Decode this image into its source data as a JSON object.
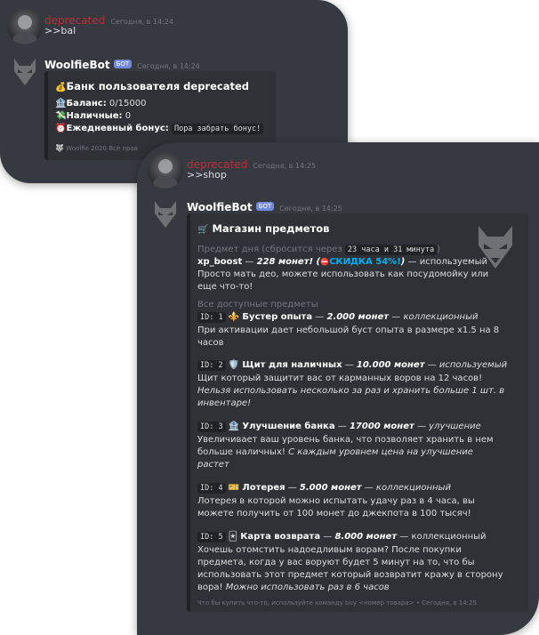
{
  "card1": {
    "user_msg": {
      "username": "deprecated",
      "timestamp": "Сегодня, в 14:24",
      "text": ">>bal"
    },
    "bot_msg": {
      "username": "WoolfieBot",
      "badge": "БОТ",
      "timestamp": "Сегодня, в 14:24"
    },
    "embed": {
      "title_icon": "money-bag-icon",
      "title": "Банк пользователя deprecated",
      "balance_label": "Баланс:",
      "balance_value": "0/15000",
      "cash_label": "Наличные:",
      "cash_value": "0",
      "bonus_label": "Ежедневный бонус:",
      "bonus_value": "Пора забрать бонус!",
      "footer": "Woolfie 2020 Все прав"
    }
  },
  "card2": {
    "user_msg": {
      "username": "deprecated",
      "timestamp": "Сегодня, в 14:25",
      "text": ">>shop"
    },
    "bot_msg": {
      "username": "WoolfieBot",
      "badge": "БОТ",
      "timestamp": "Сегодня, в 14:25"
    },
    "embed": {
      "title": "Магазин предметов",
      "deal_label": "Предмет дня (сбросится через",
      "deal_timer": "23 часа и 31 минута",
      "deal_close": ")",
      "deal_item": "xp_boost",
      "deal_price": "228 монет! (",
      "deal_sale": "СКИДКА 54%!",
      "deal_price_close": ")",
      "deal_type": "— используемый",
      "deal_desc_1": "Просто мать део, можете использовать как посудомойку или",
      "deal_desc_2": "еще что-то!",
      "all_label": "Все доступные предметы",
      "items": [
        {
          "id": "ID: 1",
          "name": "Бустер опыта",
          "price": "2.000 монет",
          "type": "коллекционный",
          "desc": [
            "При активации дает небольшой буст опыта в размере x1.5 на 8",
            "часов"
          ]
        },
        {
          "id": "ID: 2",
          "name": "Щит для наличных",
          "price": "10.000 монет",
          "type": "используемый",
          "desc": [
            "Щит который защитит вас от карманных воров на 12 часов!",
            "Нельзя использовать несколько за раз и хранить больше 1 шт. в",
            "инвентаре!"
          ]
        },
        {
          "id": "ID: 3",
          "name": "Улучшение банка",
          "price": "17000 монет",
          "type": "улучшение",
          "desc": [
            "Увеличивает ваш уровень банка, что позволяет хранить в нем",
            "больше наличных!",
            "С каждым уровнем цена на улучшение",
            "растет"
          ]
        },
        {
          "id": "ID: 4",
          "name": "Лотерея",
          "price": "5.000 монет",
          "type": "коллекционный",
          "desc": [
            "Лотерея в которой можно испытать удачу раз в 4 часа, вы",
            "можете получить от 100 монет до джекпота в 100 тысяч!"
          ]
        },
        {
          "id": "ID: 5",
          "name": "Карта возврата",
          "price": "8.000 монет",
          "type": "коллекционный",
          "desc": [
            "Хочешь отомстить надоедливым ворам? После покупки",
            "предмета, когда у вас воруют будет 5 минут на то, что бы",
            "использовать этот предмет который возвратит кражу в сторону",
            "вора!",
            "Можно использовать раз в 6 часов"
          ]
        }
      ],
      "footer": "Что бы купить что-то, используйте команду buy <номер товара>",
      "footer_time": "Сегодня, в 14:25"
    }
  },
  "colors": {
    "background": "#36393f",
    "embed_bg": "#2f3136",
    "bot_badge": "#7289da",
    "username_red": "#b3323a",
    "sale_blue": "#00b0f4"
  }
}
